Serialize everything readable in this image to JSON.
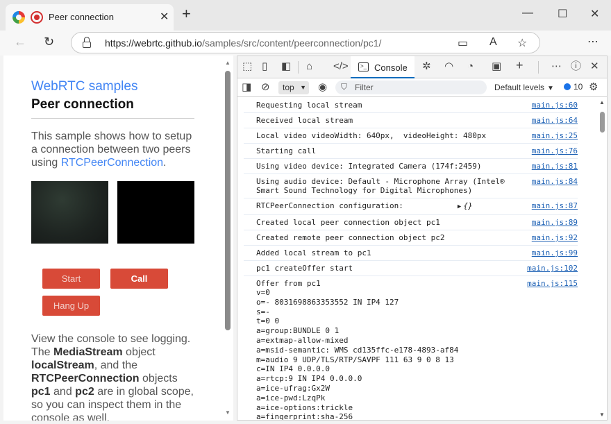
{
  "browser": {
    "tab_title": "Peer connection",
    "url_host": "https://webrtc.github.io",
    "url_path": "/samples/src/content/peerconnection/pc1/"
  },
  "page": {
    "site_title": "WebRTC samples",
    "heading": "Peer connection",
    "intro_text": "This sample shows how to setup a connection between two peers using ",
    "intro_link": "RTCPeerConnection",
    "intro_end": ".",
    "buttons": {
      "start": "Start",
      "call": "Call",
      "hangup": "Hang Up"
    },
    "outro": {
      "t1": "View the console to see logging. The ",
      "b1": "MediaStream",
      "t2": " object ",
      "b2": "localStream",
      "t3": ", and the ",
      "b3": "RTCPeerConnection",
      "t4": " objects ",
      "b4": "pc1",
      "t5": " and ",
      "b5": "pc2",
      "t6": " are in global scope, so you can inspect them in the console as well."
    }
  },
  "devtools": {
    "console_tab": "Console",
    "context": "top",
    "filter_placeholder": "Filter",
    "levels": "Default levels",
    "issues_count": "10",
    "icons": {
      "inspect": "inspect-icon",
      "device": "device-emulation-icon",
      "dock": "dock-side-icon",
      "welcome": "home-icon",
      "elements": "elements-icon",
      "sources": "bug-icon",
      "network": "wifi-icon",
      "performance": "gauge-icon",
      "memory": "chip-icon",
      "more_tools": "plus-icon",
      "more": "ellipsis-icon",
      "help": "help-icon",
      "close": "close-icon"
    },
    "logs": [
      {
        "msg": "Requesting local stream",
        "src": "main.js:60"
      },
      {
        "msg": "Received local stream",
        "src": "main.js:64"
      },
      {
        "msg": "Local video videoWidth: 640px,  videoHeight: 480px",
        "src": "main.js:25"
      },
      {
        "msg": "Starting call",
        "src": "main.js:76"
      },
      {
        "msg": "Using video device: Integrated Camera (174f:2459)",
        "src": "main.js:81"
      },
      {
        "msg": "Using audio device: Default - Microphone Array (Intel® Smart Sound Technology for Digital Microphones)",
        "src": "main.js:84"
      },
      {
        "msg": "RTCPeerConnection configuration:",
        "obj": "{}",
        "src": "main.js:87"
      },
      {
        "msg": "Created local peer connection object pc1",
        "src": "main.js:89"
      },
      {
        "msg": "Created remote peer connection object pc2",
        "src": "main.js:92"
      },
      {
        "msg": "Added local stream to pc1",
        "src": "main.js:99"
      },
      {
        "msg": "pc1 createOffer start",
        "src": "main.js:102"
      }
    ],
    "offer": {
      "msg": "Offer from pc1",
      "src": "main.js:115",
      "sdp": [
        "v=0",
        "o=- 8031698863353552 IN IP4 127",
        "s=-",
        "t=0 0",
        "a=group:BUNDLE 0 1",
        "a=extmap-allow-mixed",
        "a=msid-semantic: WMS cd135ffc-e178-4893-af84",
        "m=audio 9 UDP/TLS/RTP/SAVPF 111 63 9 0 8 13",
        "c=IN IP4 0.0.0.0",
        "a=rtcp:9 IN IP4 0.0.0.0",
        "a=ice-ufrag:Gx2W",
        "a=ice-pwd:LzqPk",
        "a=ice-options:trickle",
        "a=fingerprint:sha-256"
      ]
    }
  }
}
